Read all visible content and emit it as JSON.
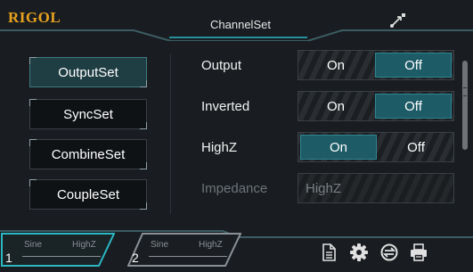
{
  "header": {
    "brand": "RIGOL",
    "title": "ChannelSet"
  },
  "nav": {
    "items": [
      {
        "label": "OutputSet",
        "active": true
      },
      {
        "label": "SyncSet",
        "active": false
      },
      {
        "label": "CombineSet",
        "active": false
      },
      {
        "label": "CoupleSet",
        "active": false
      }
    ]
  },
  "settings": {
    "output": {
      "label": "Output",
      "on": "On",
      "off": "Off",
      "selected": "Off"
    },
    "inverted": {
      "label": "Inverted",
      "on": "On",
      "off": "Off",
      "selected": "Off"
    },
    "highz": {
      "label": "HighZ",
      "on": "On",
      "off": "Off",
      "selected": "On"
    },
    "impedance": {
      "label": "Impedance",
      "value": "HighZ",
      "enabled": false
    }
  },
  "channels": [
    {
      "num": "1",
      "wave": "Sine",
      "impedance": "HighZ",
      "active": true
    },
    {
      "num": "2",
      "wave": "Sine",
      "impedance": "HighZ",
      "active": false
    }
  ],
  "icons": [
    "usb-icon",
    "file-icon",
    "gear-icon",
    "sync-icon",
    "printer-icon"
  ],
  "colors": {
    "brand": "#e8a21e",
    "accent": "#2f8592",
    "selected": "#1d5b66",
    "active_channel": "#2bb7c4"
  }
}
